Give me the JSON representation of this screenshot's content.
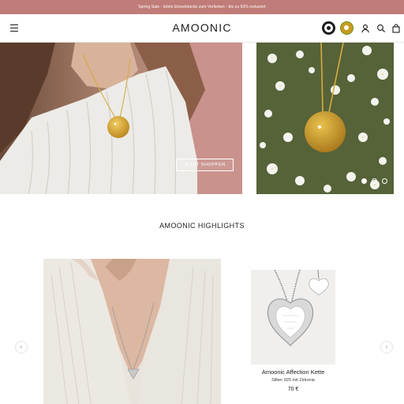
{
  "announcement": {
    "text": "Spring Sale - letzte Einzelstücke zum Verlieben - bis zu 50% reduziert"
  },
  "header": {
    "logo": "AMOONIC",
    "icons": [
      "menu-icon",
      "trust-badge-icon",
      "award-badge-icon",
      "account-icon",
      "search-icon",
      "cart-icon"
    ]
  },
  "hero": {
    "button_label": "JETZT SHOPPEN",
    "slides_total": 3,
    "active_slide": 1
  },
  "highlights": {
    "title": "AMOONIC HIGHLIGHTS",
    "product": {
      "name": "Amoonic Affection Kette",
      "subtitle": "Silber 925 mit Zirkonia",
      "price": "70 €"
    },
    "prev_icon": "chevron-left-icon",
    "next_icon": "chevron-right-icon"
  },
  "colors": {
    "announcement_bg": "#c07c78",
    "text": "#1c1b1b",
    "card_bg": "#f0efed"
  }
}
